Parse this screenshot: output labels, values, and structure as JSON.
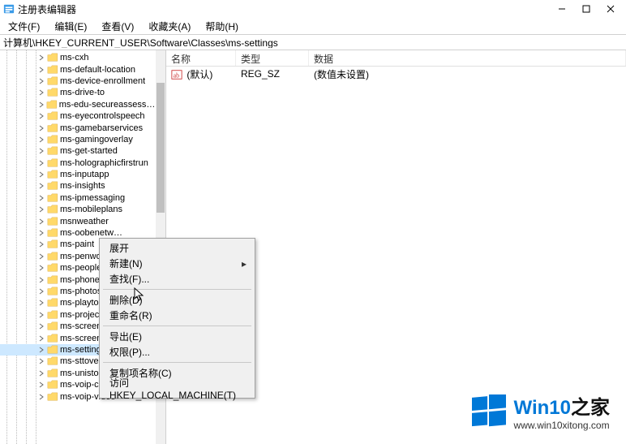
{
  "title": "注册表编辑器",
  "menubar": {
    "file": "文件(F)",
    "edit": "编辑(E)",
    "view": "查看(V)",
    "favorites": "收藏夹(A)",
    "help": "帮助(H)"
  },
  "address": "计算机\\HKEY_CURRENT_USER\\Software\\Classes\\ms-settings",
  "tree": {
    "items": [
      "ms-cxh",
      "ms-default-location",
      "ms-device-enrollment",
      "ms-drive-to",
      "ms-edu-secureassessment",
      "ms-eyecontrolspeech",
      "ms-gamebarservices",
      "ms-gamingoverlay",
      "ms-get-started",
      "ms-holographicfirstrun",
      "ms-inputapp",
      "ms-insights",
      "ms-ipmessaging",
      "ms-mobileplans",
      "msnweather",
      "ms-oobenetwork",
      "ms-paint",
      "ms-penworkspace",
      "ms-people",
      "ms-phone",
      "ms-photos",
      "ms-playto-miracast",
      "ms-projection",
      "ms-screenclip",
      "ms-screensketch",
      "ms-settings",
      "ms-sttoverlay",
      "ms-unistore-email",
      "ms-voip-call",
      "ms-voip-video"
    ],
    "selected": 25,
    "trunc_start": 15,
    "trunc_end": 24
  },
  "list": {
    "headers": {
      "name": "名称",
      "type": "类型",
      "data": "数据"
    },
    "rows": [
      {
        "name": "(默认)",
        "type": "REG_SZ",
        "data": "(数值未设置)"
      }
    ]
  },
  "context_menu": {
    "expand": "展开",
    "new": "新建(N)",
    "find": "查找(F)...",
    "delete": "删除(D)",
    "rename": "重命名(R)",
    "export": "导出(E)",
    "permissions": "权限(P)...",
    "copy_key_name": "复制项名称(C)",
    "goto_hklm": "访问 HKEY_LOCAL_MACHINE(T)"
  },
  "watermark": {
    "brand_prefix": "Win10",
    "brand_suffix": "之家",
    "url": "www.win10xitong.com"
  }
}
